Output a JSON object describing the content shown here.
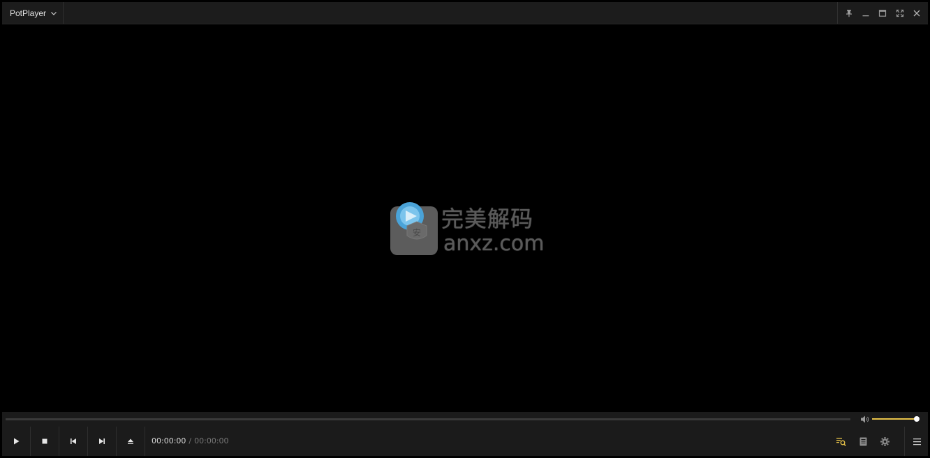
{
  "window": {
    "app_name": "PotPlayer",
    "title": ""
  },
  "watermark": {
    "line1": "完美解码",
    "line2": "anxz.com"
  },
  "playback": {
    "current_time": "00:00:00",
    "separator": "/",
    "duration": "00:00:00",
    "progress": 0,
    "volume": 1.0
  },
  "colors": {
    "accent": "#e8c34a",
    "titlebar_bg": "#1c1c1c",
    "controlbar_bg": "#1b1b1b",
    "video_bg": "#000000"
  },
  "icons": {
    "app_menu": "chevron-down-icon",
    "pin": "pin-icon",
    "minimize": "minimize-icon",
    "maximize": "maximize-icon",
    "fullscreen": "fullscreen-icon",
    "close": "close-icon",
    "play": "play-icon",
    "stop": "stop-icon",
    "prev": "previous-icon",
    "next": "next-icon",
    "eject": "eject-icon",
    "volume": "volume-icon",
    "playlist_search": "playlist-search-icon",
    "chapters": "chapter-list-icon",
    "settings": "gear-icon",
    "menu": "hamburger-menu-icon"
  }
}
